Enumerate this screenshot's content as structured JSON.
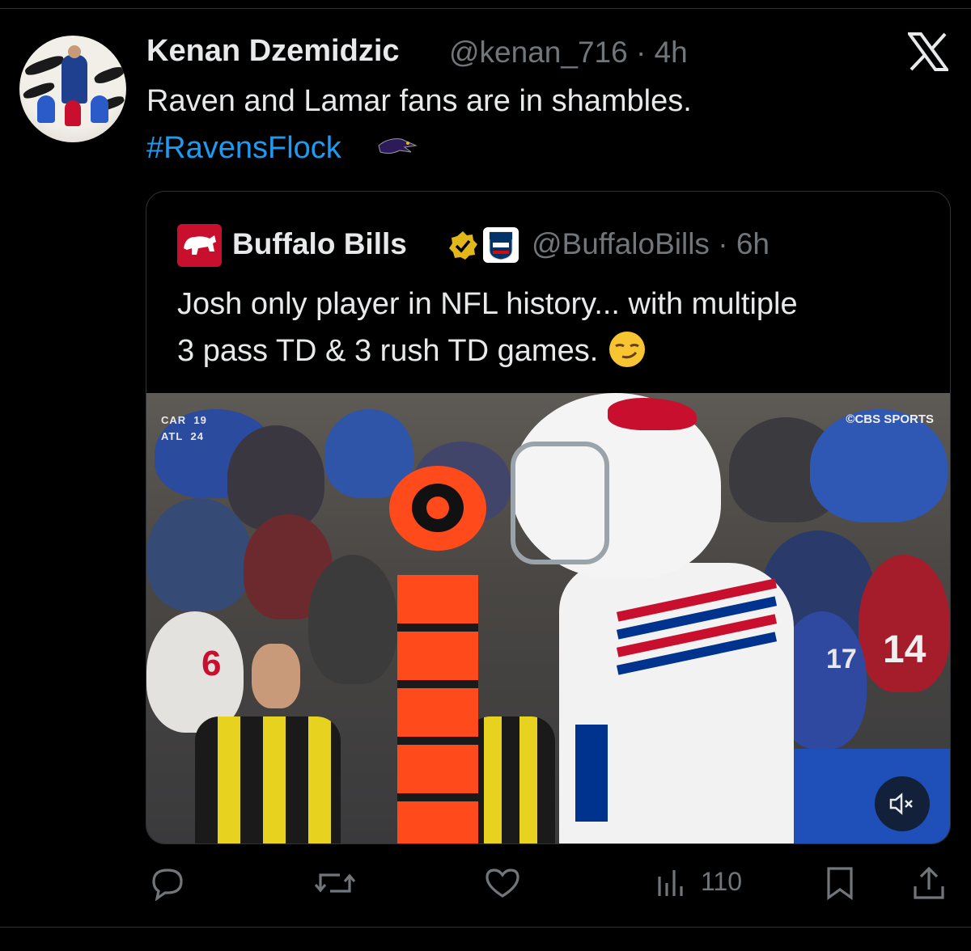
{
  "tweet": {
    "author_name": "Kenan Dzemidzic",
    "author_handle": "@kenan_716",
    "separator": "·",
    "time": "4h",
    "text": "Raven and Lamar fans are in shambles.",
    "hashtag": "#RavensFlock",
    "hashtag_emoji_icon": "ravens-logo-icon"
  },
  "quote": {
    "author_name": "Buffalo Bills",
    "author_handle": "@BuffaloBills",
    "separator": "·",
    "time": "6h",
    "text_line1": "Josh only player in NFL history... with multiple",
    "text_line2": "3 pass TD & 3 rush TD games.",
    "emoji_icon": "smirking-face-icon",
    "media": {
      "type": "video",
      "watermark": "©CBS SPORTS",
      "scorebug": [
        {
          "team": "CAR",
          "score": "19"
        },
        {
          "team": "ATL",
          "score": "24"
        }
      ],
      "jersey_numbers": [
        "6",
        "17",
        "14"
      ]
    }
  },
  "actions": {
    "views": "110"
  },
  "colors": {
    "background": "#000000",
    "text": "#e7e9ea",
    "muted": "#71767b",
    "link": "#1d9bf0",
    "border": "#2f3336",
    "bills_red": "#c8102e",
    "verified_gold": "#e2b719"
  }
}
